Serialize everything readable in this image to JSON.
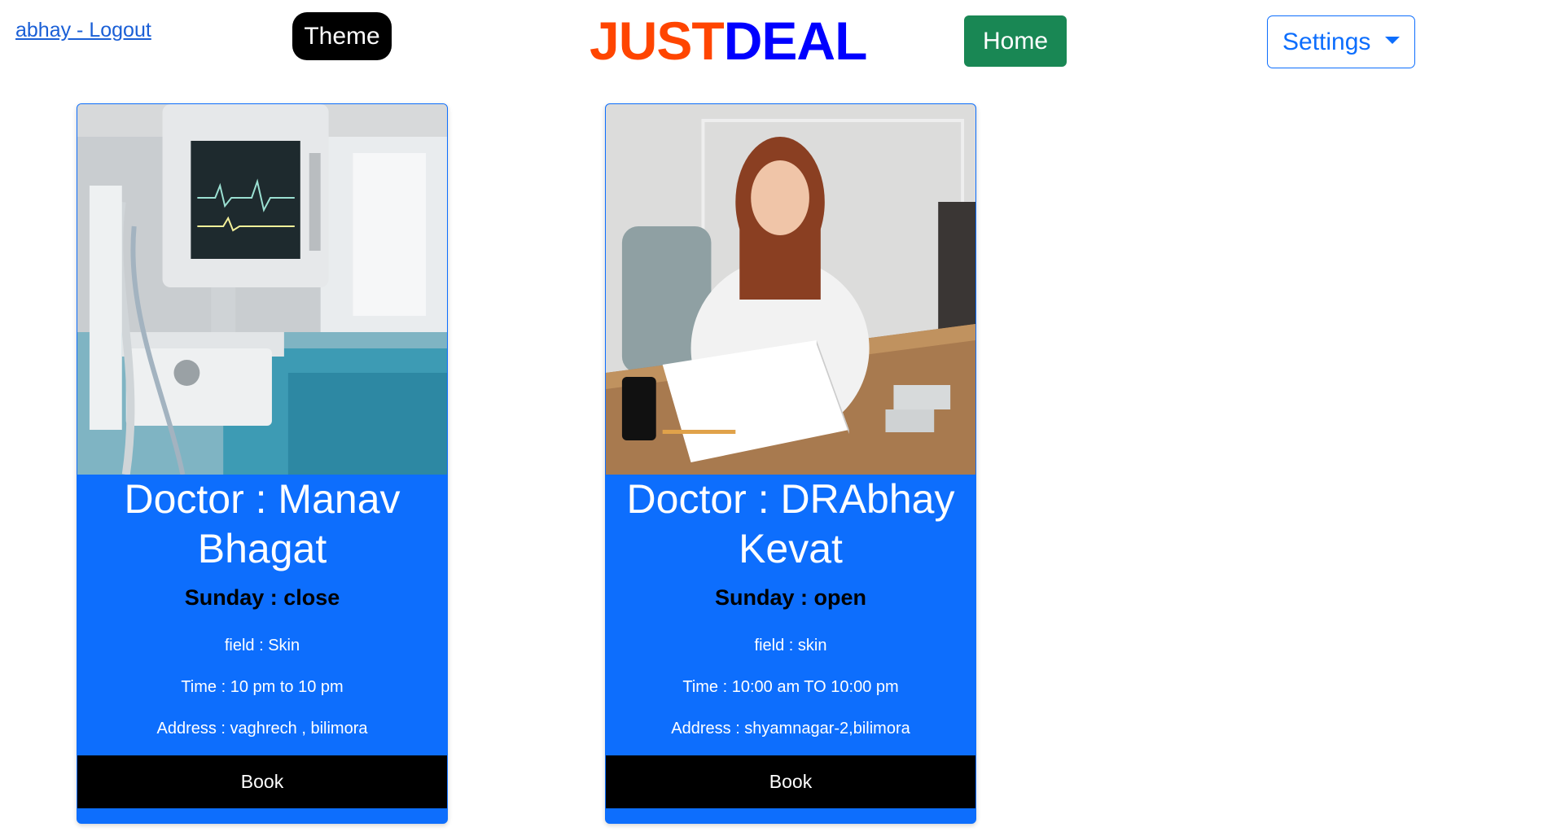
{
  "header": {
    "logout_link": "abhay - Logout",
    "theme_button": "Theme",
    "brand_part1": "JUST",
    "brand_part2": "DEAL",
    "home_button": "Home",
    "settings_button": "Settings"
  },
  "colors": {
    "brand_orange": "#ff4500",
    "brand_blue": "#0000ff",
    "card_blue": "#0d6efd",
    "home_green": "#198754",
    "book_black": "#000000"
  },
  "cards": [
    {
      "doctor": "Doctor : Manav Bhagat",
      "sunday": "Sunday : close",
      "field": "field : Skin",
      "time": "Time : 10 pm to 10 pm",
      "address": "Address : vaghrech , bilimora",
      "book_button": "Book",
      "image_icon": "hospital-monitor-photo"
    },
    {
      "doctor": "Doctor : DRAbhay Kevat",
      "sunday": "Sunday : open",
      "field": "field : skin",
      "time": "Time : 10:00 am TO 10:00 pm",
      "address": "Address : shyamnagar-2,bilimora",
      "book_button": "Book",
      "image_icon": "doctor-writing-photo"
    }
  ]
}
